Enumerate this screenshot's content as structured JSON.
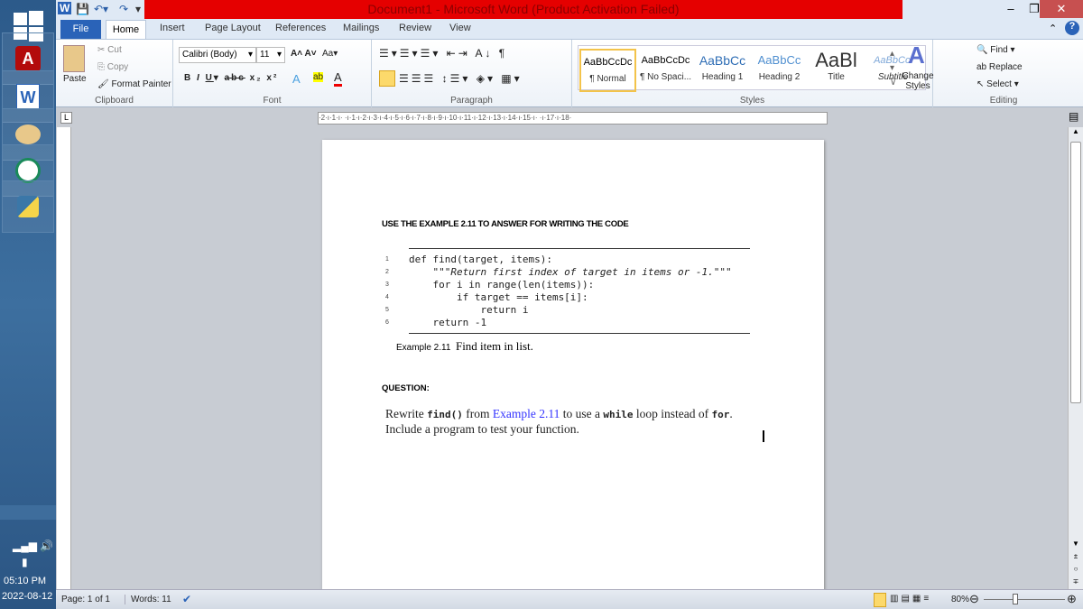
{
  "window": {
    "title": "Document1  -  Microsoft Word (Product Activation Failed)"
  },
  "taskbar": {
    "time": "05:10 PM",
    "date": "2022-08-12"
  },
  "tabs": [
    "File",
    "Home",
    "Insert",
    "Page Layout",
    "References",
    "Mailings",
    "Review",
    "View"
  ],
  "clipboard": {
    "paste": "Paste",
    "cut": "Cut",
    "copy": "Copy",
    "format_painter": "Format Painter",
    "label": "Clipboard"
  },
  "font": {
    "name": "Calibri (Body)",
    "size": "11",
    "label": "Font"
  },
  "paragraph": {
    "label": "Paragraph"
  },
  "styles": {
    "items": [
      {
        "preview": "AaBbCcDc",
        "name": "¶ Normal"
      },
      {
        "preview": "AaBbCcDc",
        "name": "¶ No Spaci..."
      },
      {
        "preview": "AaBbCc",
        "name": "Heading 1"
      },
      {
        "preview": "AaBbCc",
        "name": "Heading 2"
      },
      {
        "preview": "AaBl",
        "name": "Title"
      },
      {
        "preview": "AaBbCcl",
        "name": "Subtitle"
      }
    ],
    "change_styles": "Change Styles",
    "label": "Styles"
  },
  "editing": {
    "find": "Find",
    "replace": "Replace",
    "select": "Select",
    "label": "Editing"
  },
  "ruler": "·2·ı·1·ı·  ·ı·1·ı·2·ı·3·ı·4·ı·5·ı·6·ı·7·ı·8·ı·9·ı·10·ı·11·ı·12·ı·13·ı·14·ı·15·ı·  ·ı·17·ı·18·",
  "document": {
    "heading": "USE THE EXAMPLE 2.11 TO ANSWER FOR WRITING THE CODE",
    "code": [
      {
        "n": "1",
        "text": "def find(target, items):"
      },
      {
        "n": "2",
        "text": "    \"\"\"Return first index of target in items or -1.\"\"\""
      },
      {
        "n": "3",
        "text": "    for i in range(len(items)):"
      },
      {
        "n": "4",
        "text": "        if target == items[i]:"
      },
      {
        "n": "5",
        "text": "            return i"
      },
      {
        "n": "6",
        "text": "    return -1"
      }
    ],
    "caption_label": "Example 2.11",
    "caption_text": "Find item in list.",
    "question_label": "QUESTION:",
    "q1": "Rewrite ",
    "q_code1": "find()",
    "q2": " from ",
    "q_link": "Example 2.11",
    "q3": " to use a ",
    "q_code2": "while",
    "q4": " loop instead of ",
    "q_code3": "for",
    "q5": ".",
    "q_line2": "Include a program to test your function."
  },
  "status": {
    "page": "Page: 1 of 1",
    "words": "Words: 11",
    "zoom": "80%",
    "zoom_level": 80
  },
  "colors": {
    "title_bar": "#e50000",
    "file_tab": "#2a63b8",
    "link": "#3333ff"
  }
}
